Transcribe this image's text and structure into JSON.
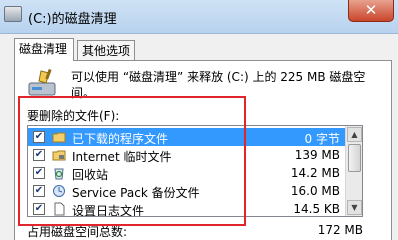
{
  "window": {
    "title": "(C:)的磁盘清理",
    "close_glyph": "✕"
  },
  "tabs": [
    {
      "label": "磁盘清理",
      "active": true
    },
    {
      "label": "其他选项",
      "active": false
    }
  ],
  "description": "可以使用 “磁盘清理” 来释放 (C:) 上的 225 MB 磁盘空间。",
  "files_label": "要删除的文件(F):",
  "files": [
    {
      "checked": true,
      "name": "已下载的程序文件",
      "size": "0 字节",
      "selected": true,
      "icon": "folder-icon"
    },
    {
      "checked": true,
      "name": "Internet 临时文件",
      "size": "139 MB",
      "selected": false,
      "icon": "folder-lock-icon"
    },
    {
      "checked": true,
      "name": "回收站",
      "size": "14.2 MB",
      "selected": false,
      "icon": "recycle-bin-icon"
    },
    {
      "checked": true,
      "name": "Service Pack 备份文件",
      "size": "16.0 MB",
      "selected": false,
      "icon": "backup-icon"
    },
    {
      "checked": true,
      "name": "设置日志文件",
      "size": "14.5 KB",
      "selected": false,
      "icon": "document-icon"
    }
  ],
  "total": {
    "label": "占用磁盘空间总数:",
    "value": "172 MB"
  },
  "colors": {
    "selection": "#3399ff",
    "highlight_border": "#e0262b"
  }
}
